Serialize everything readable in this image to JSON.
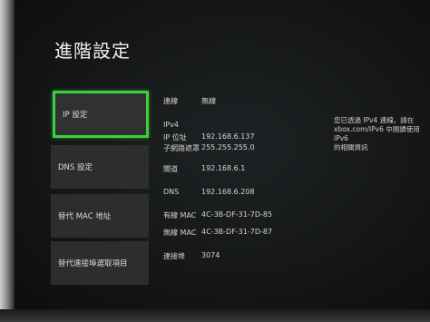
{
  "page_title": "進階設定",
  "menu": [
    {
      "label": "IP 設定",
      "selected": true
    },
    {
      "label": "DNS 設定",
      "selected": false
    },
    {
      "label": "替代 MAC 地址",
      "selected": false
    },
    {
      "label": "替代連接埠選取項目",
      "selected": false
    }
  ],
  "details": {
    "connection_label": "連線",
    "connection_value": "無線",
    "ipv4_header": "IPv4",
    "ip_label": "IP 位址",
    "ip_value": "192.168.6.137",
    "subnet_label": "子網路遮罩",
    "subnet_value": "255.255.255.0",
    "gateway_label": "閘道",
    "gateway_value": "192.168.6.1",
    "dns_label": "DNS",
    "dns_value": "192.168.6.208",
    "wired_mac_label": "有線 MAC",
    "wired_mac_value": "4C-3B-DF-31-7D-85",
    "wireless_mac_label": "無線 MAC",
    "wireless_mac_value": "4C-3B-DF-31-7D-87",
    "port_label": "連接埠",
    "port_value": "3074"
  },
  "hint": {
    "line1": "您已透過 IPv4 連線。請在",
    "line2": "xbox.com/IPv6 中閱讀使用 IPv6",
    "line3": "的相關資訊"
  },
  "colors": {
    "selection": "#3bd13b",
    "tile": "#2b2d2f",
    "background": "#141617"
  }
}
